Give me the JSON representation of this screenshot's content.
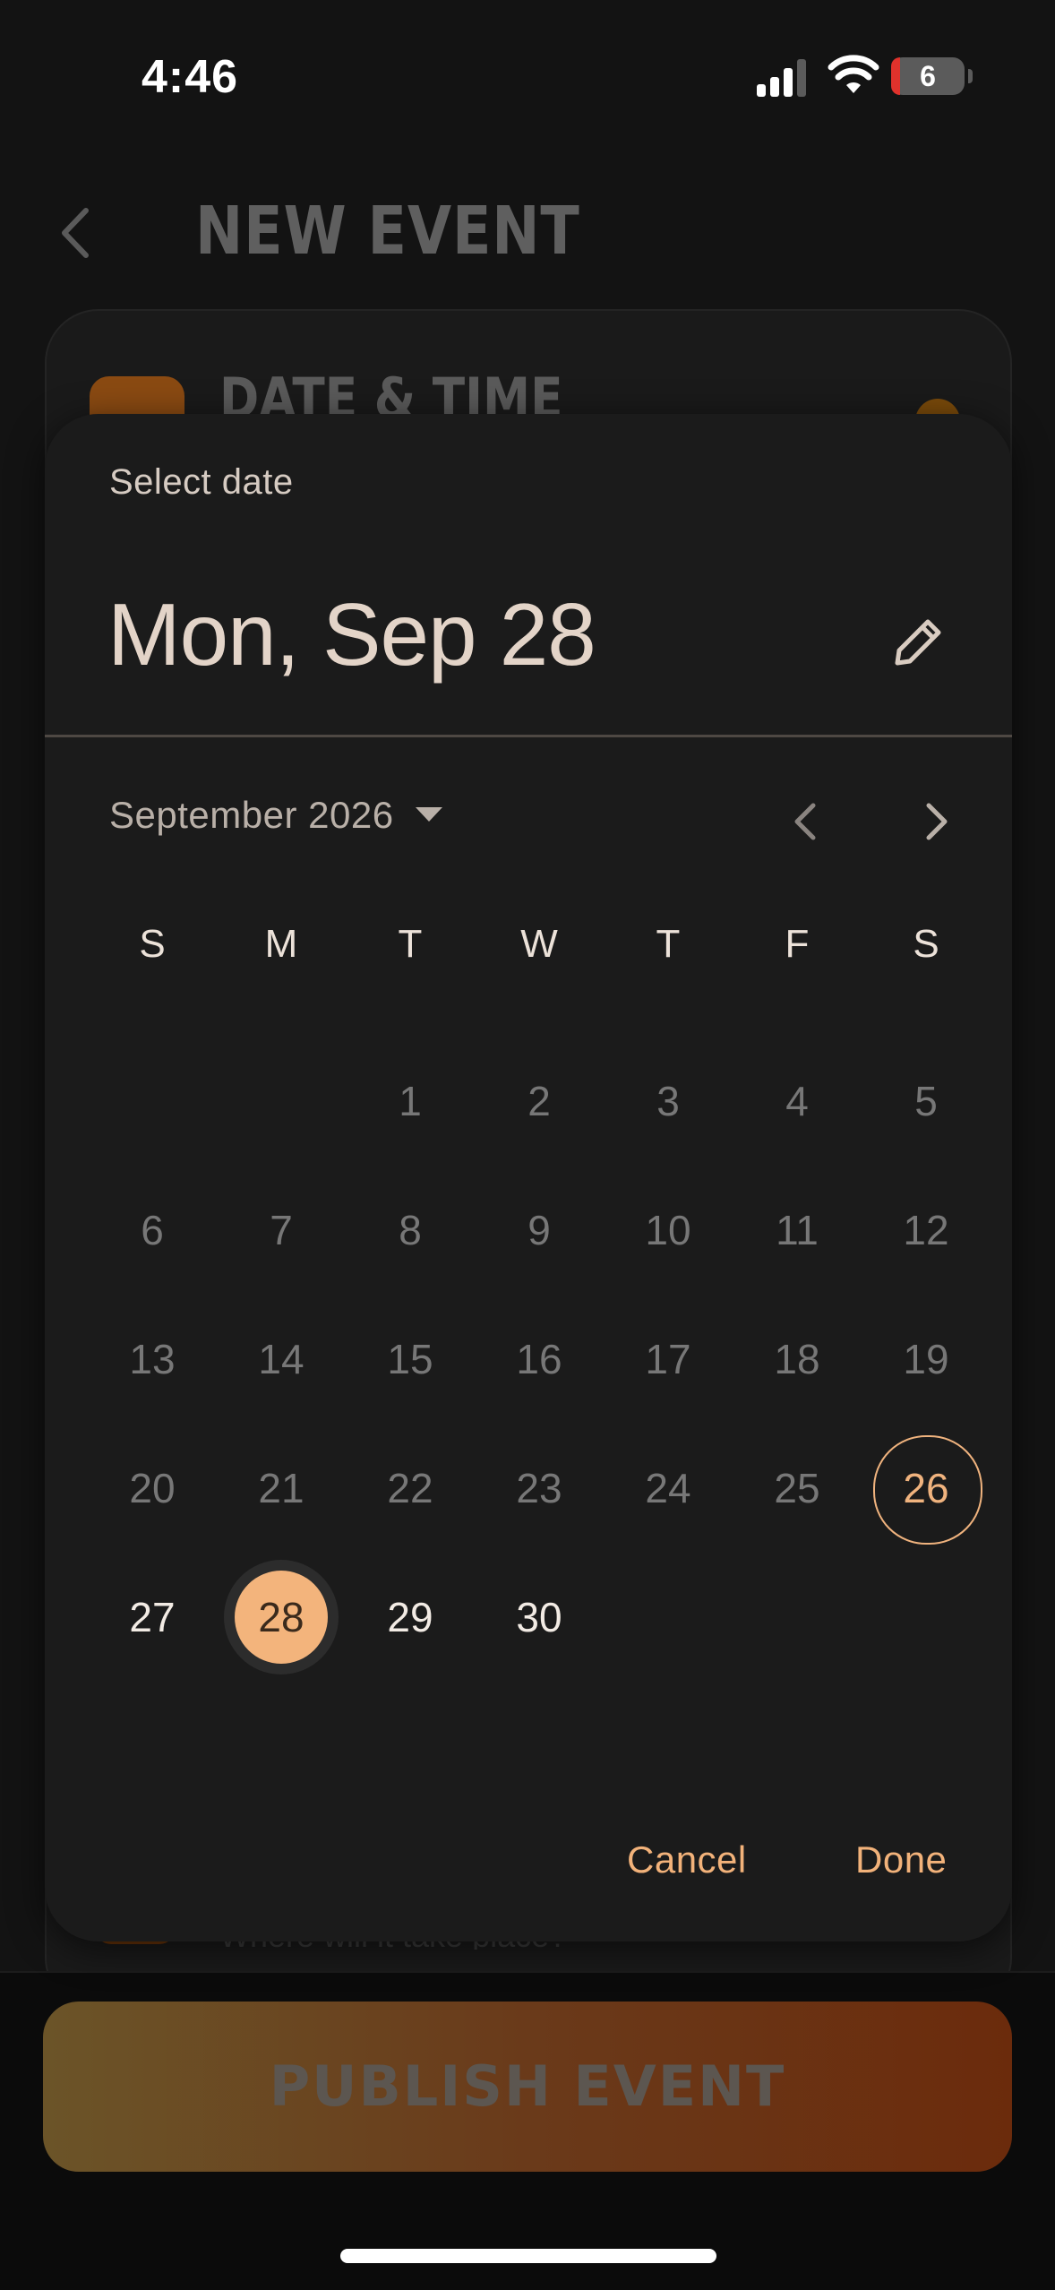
{
  "status_bar": {
    "time": "4:46",
    "battery": "6"
  },
  "header": {
    "title": "NEW EVENT"
  },
  "card": {
    "title": "DATE & TIME"
  },
  "location": {
    "hint": "Where will it take place?"
  },
  "publish": {
    "label": "PUBLISH EVENT"
  },
  "dialog": {
    "label": "Select date",
    "selected_date": "Mon, Sep 28",
    "month_label": "September 2026",
    "weekdays": [
      "S",
      "M",
      "T",
      "W",
      "T",
      "F",
      "S"
    ],
    "leading_blanks": 2,
    "days": [
      "1",
      "2",
      "3",
      "4",
      "5",
      "6",
      "7",
      "8",
      "9",
      "10",
      "11",
      "12",
      "13",
      "14",
      "15",
      "16",
      "17",
      "18",
      "19",
      "20",
      "21",
      "22",
      "23",
      "24",
      "25",
      "26",
      "27",
      "28",
      "29",
      "30"
    ],
    "today": "26",
    "selected": "28",
    "cancel_label": "Cancel",
    "done_label": "Done"
  },
  "colors": {
    "accent": "#f3b47c",
    "dialog_bg": "#1b1b1b",
    "page_bg": "#131313"
  }
}
